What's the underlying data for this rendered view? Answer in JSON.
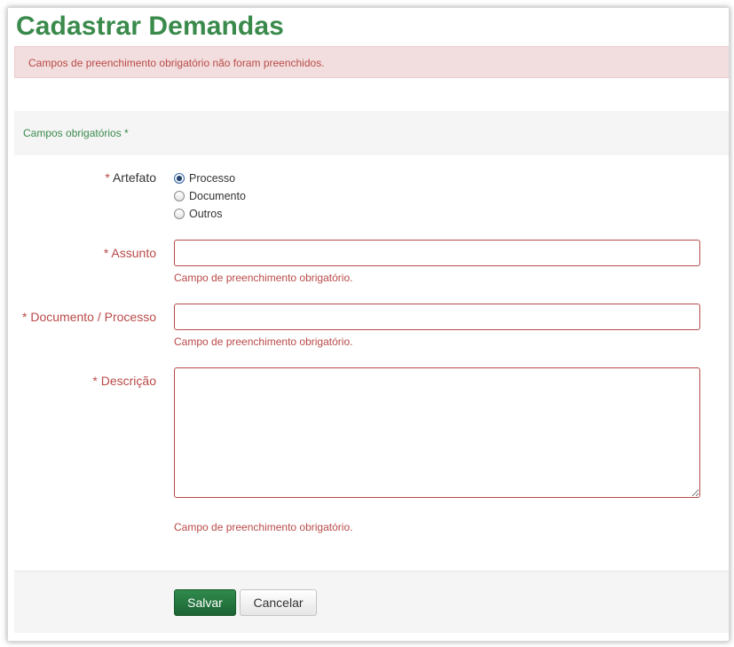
{
  "page": {
    "title": "Cadastrar Demandas"
  },
  "alert": {
    "message": "Campos de preenchimento obrigatório não foram preenchidos."
  },
  "required_section": {
    "title": "Campos obrigatórios *"
  },
  "form": {
    "required_marker": "*",
    "artefato": {
      "label": "Artefato",
      "selected": "Processo",
      "options": [
        "Processo",
        "Documento",
        "Outros"
      ]
    },
    "assunto": {
      "label": "Assunto",
      "value": "",
      "error": "Campo de preenchimento obrigatório."
    },
    "documento_processo": {
      "label": "Documento / Processo",
      "value": "",
      "error": "Campo de preenchimento obrigatório."
    },
    "descricao": {
      "label": "Descrição",
      "value": "",
      "error": "Campo de preenchimento obrigatório."
    }
  },
  "actions": {
    "save_label": "Salvar",
    "cancel_label": "Cancelar"
  },
  "colors": {
    "title_green": "#3a8a4c",
    "error_red": "#b94a48",
    "alert_background": "#f2dede",
    "save_button_green": "#1d6435"
  }
}
